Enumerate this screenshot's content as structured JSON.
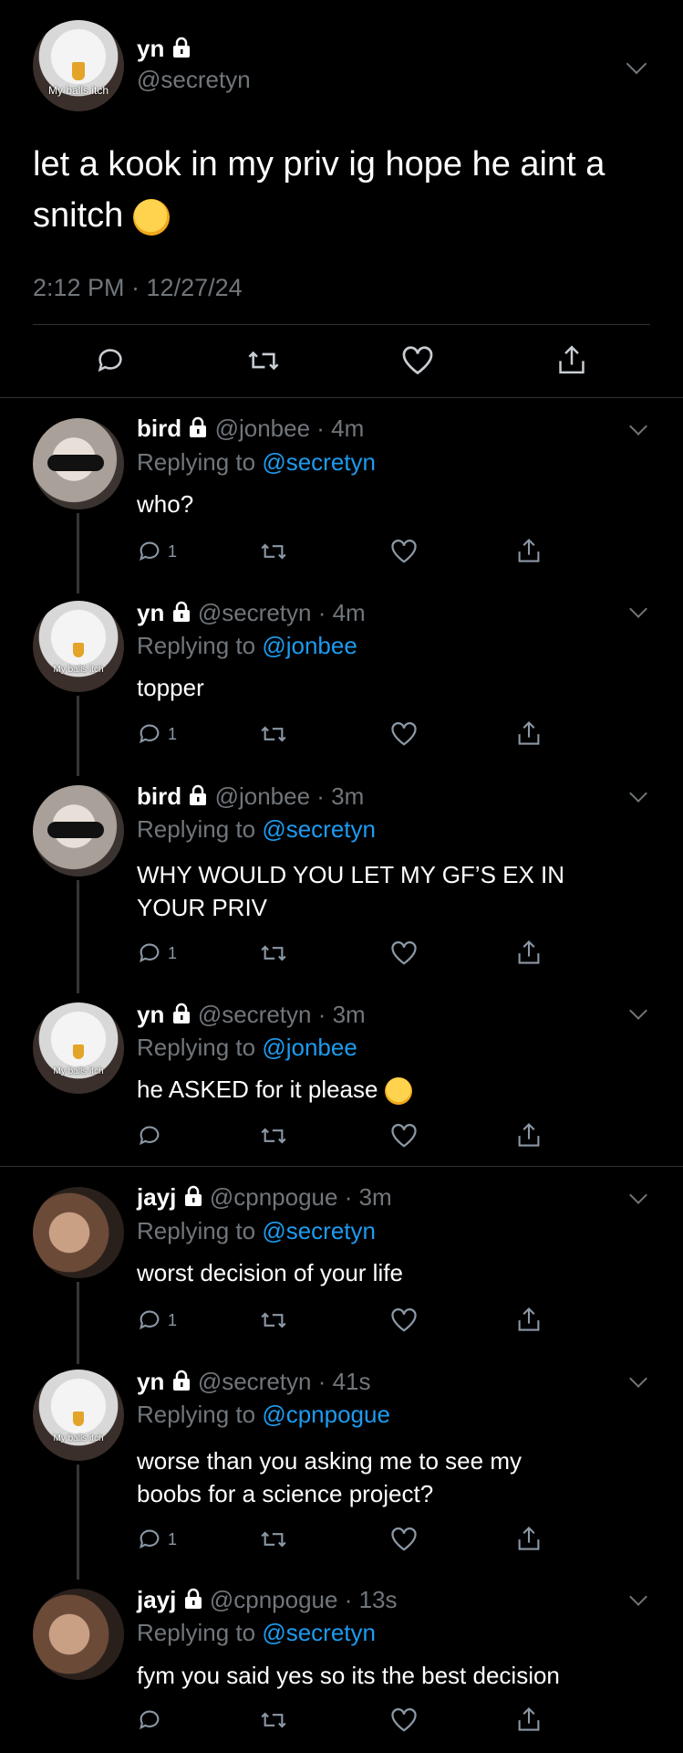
{
  "main_tweet": {
    "name": "yn",
    "handle": "@secretyn",
    "avatar_text": "My balls itch",
    "text": "let a kook in my priv ig hope he aint a snitch",
    "emoji": "laughing-rolling-emoji",
    "timestamp": "2:12 PM · 12/27/24"
  },
  "replies": [
    {
      "name": "bird",
      "handle": "@jonbee",
      "time": "· 4m",
      "replying_label": "Replying to",
      "replying_to": "@secretyn",
      "text": "who?",
      "reply_count": "1",
      "avatar": "person"
    },
    {
      "name": "yn",
      "handle": "@secretyn",
      "time": "· 4m",
      "replying_label": "Replying to",
      "replying_to": "@jonbee",
      "text": "topper",
      "reply_count": "1",
      "avatar": "eagle",
      "avatar_text": "My balls itch"
    },
    {
      "name": "bird",
      "handle": "@jonbee",
      "time": "· 3m",
      "replying_label": "Replying to",
      "replying_to": "@secretyn",
      "text_line1": "WHY WOULD YOU LET MY GF’S EX IN",
      "text_line2": "YOUR PRIV",
      "reply_count": "1",
      "avatar": "person"
    },
    {
      "name": "yn",
      "handle": "@secretyn",
      "time": "· 3m",
      "replying_label": "Replying to",
      "replying_to": "@jonbee",
      "text": "he ASKED for it please",
      "emoji": "tired-face-emoji",
      "reply_count": "",
      "avatar": "eagle",
      "avatar_text": "My balls itch"
    },
    {
      "name": "jayj",
      "handle": "@cpnpogue",
      "time": "· 3m",
      "replying_label": "Replying to",
      "replying_to": "@secretyn",
      "text": "worst decision of your life",
      "reply_count": "1",
      "avatar": "person2"
    },
    {
      "name": "yn",
      "handle": "@secretyn",
      "time": "· 41s",
      "replying_label": "Replying to",
      "replying_to": "@cpnpogue",
      "text_line1": "worse than you asking me to see my",
      "text_line2": "boobs for a science project?",
      "reply_count": "1",
      "avatar": "eagle",
      "avatar_text": "My balls itch"
    },
    {
      "name": "jayj",
      "handle": "@cpnpogue",
      "time": "· 13s",
      "replying_label": "Replying to",
      "replying_to": "@secretyn",
      "text": "fym you said yes so its the best decision",
      "reply_count": "",
      "avatar": "person2"
    }
  ],
  "colors": {
    "background": "#000000",
    "link": "#1d9bf0",
    "muted": "#71767b",
    "divider": "#2f3336"
  }
}
